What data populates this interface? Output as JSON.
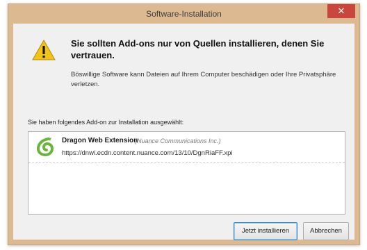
{
  "window": {
    "title": "Software-Installation",
    "close_glyph": "✕"
  },
  "warning": {
    "icon": "warning-icon",
    "heading": "Sie sollten Add-ons nur von Quellen installieren, denen Sie vertrauen.",
    "description": "Böswillige Software kann Dateien auf Ihrem Computer beschädigen oder Ihre Privatsphäre verletzen."
  },
  "addons": {
    "intro": "Sie haben folgendes Add-on zur Installation ausgewählt:",
    "items": [
      {
        "name": "Dragon Web Extension",
        "vendor": "(Nuance Communications Inc.)",
        "url": "https://dnwi.ecdn.content.nuance.com/13/10/DgnRiaFF.xpi",
        "icon": "dragon-logo-icon"
      }
    ]
  },
  "buttons": {
    "install": "Jetzt installieren",
    "cancel": "Abbrechen"
  },
  "colors": {
    "titlebar": "#dcb991",
    "close": "#c8463b",
    "warning_yellow": "#f2c318",
    "dragon_green": "#6bb43a"
  }
}
